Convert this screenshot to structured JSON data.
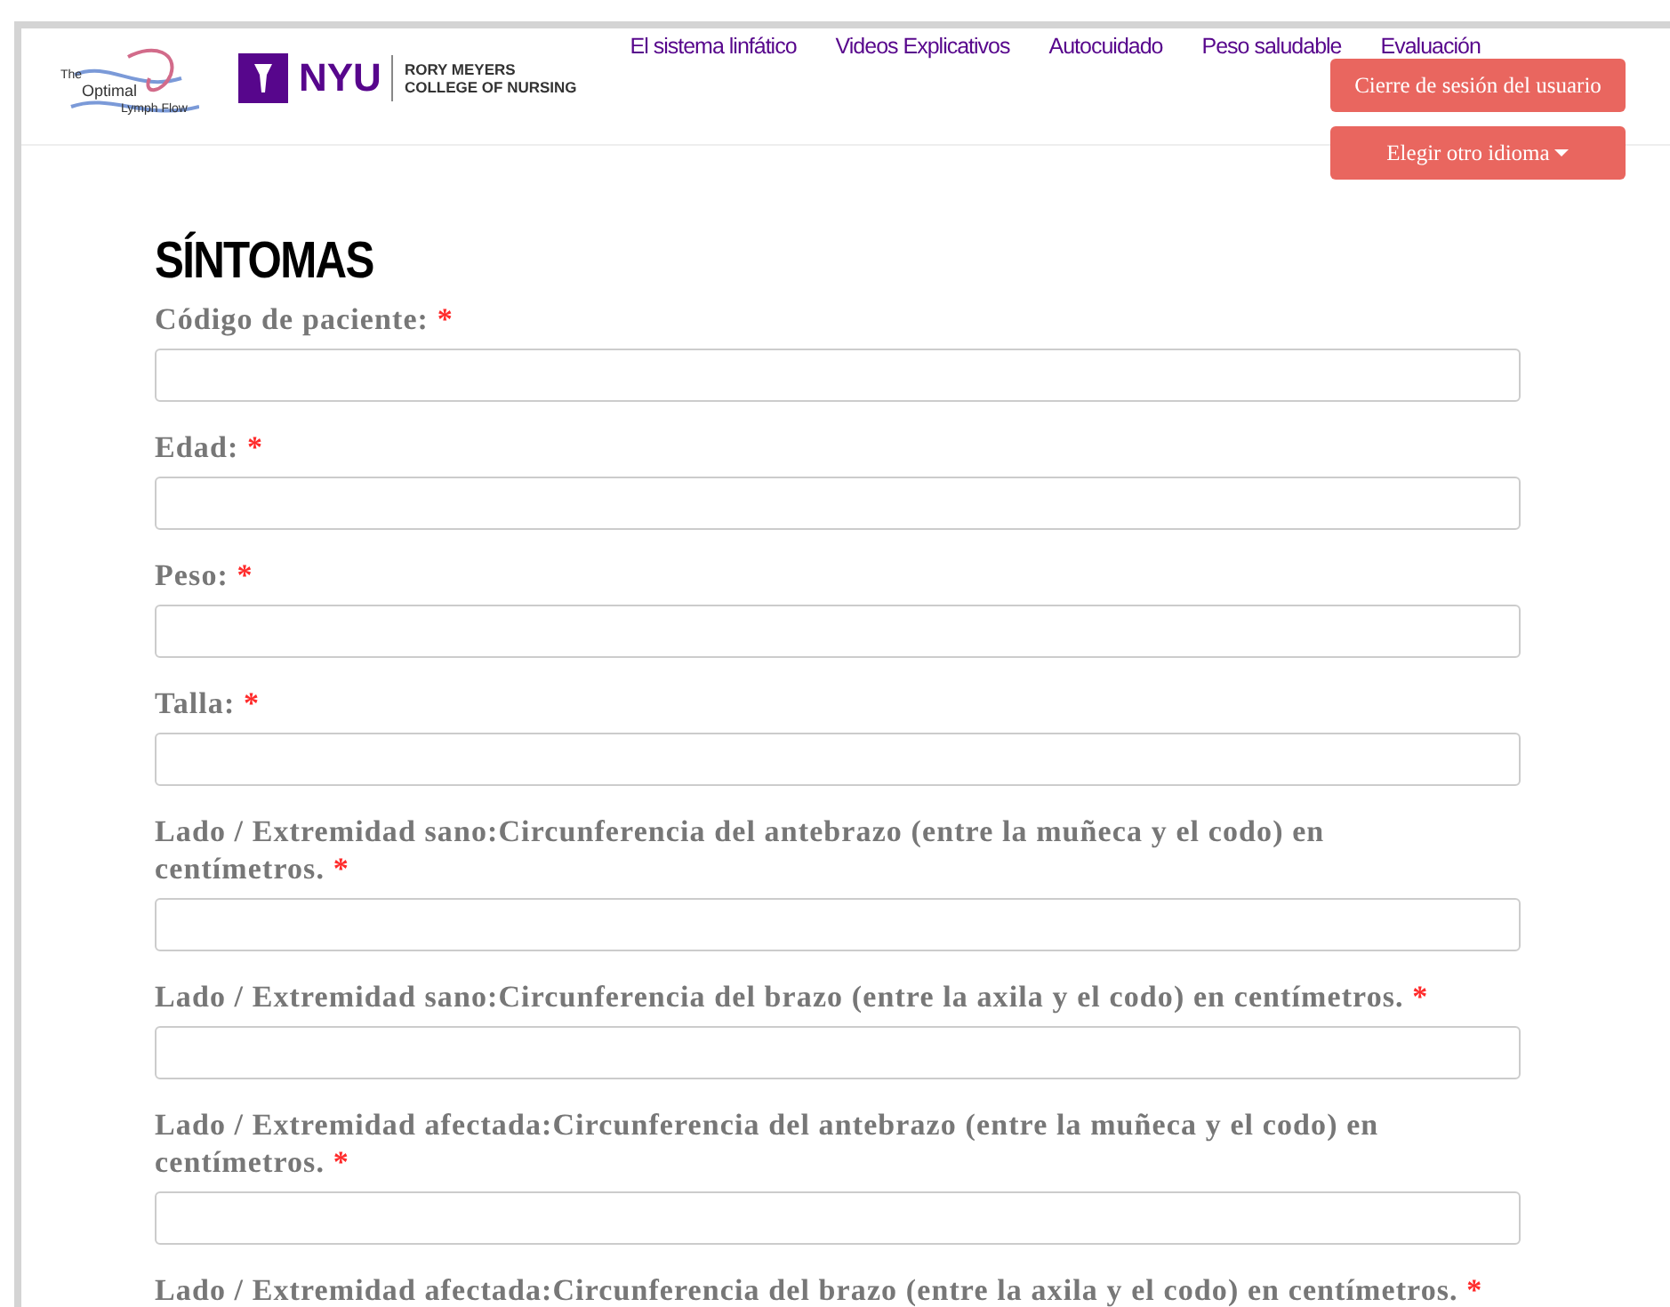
{
  "header": {
    "logo_optimal": [
      "The",
      "Optimal",
      "Lymph Flow"
    ],
    "logo_nyu": {
      "mark": "NYU",
      "line1": "RORY MEYERS",
      "line2": "COLLEGE OF NURSING"
    },
    "nav": [
      "El sistema linfático",
      "Videos Explicativos",
      "Autocuidado",
      "Peso saludable",
      "Evaluación"
    ],
    "buttons": [
      {
        "label": "Cierre de sesión del usuario",
        "kind": "plain"
      },
      {
        "label": "Elegir otro idioma",
        "kind": "dropdown"
      }
    ]
  },
  "title": "SÍNTOMAS",
  "fields": [
    {
      "label": "Código de paciente:",
      "required_mark": "*"
    },
    {
      "label": "Edad:",
      "required_mark": "*"
    },
    {
      "label": "Peso:",
      "required_mark": "*"
    },
    {
      "label": "Talla:",
      "required_mark": "*"
    },
    {
      "label": "Lado / Extremidad sano:Circunferencia del antebrazo (entre la muñeca y el codo) en centímetros.",
      "required_mark": "*"
    },
    {
      "label": "Lado / Extremidad sano:Circunferencia del brazo (entre la axila y el codo) en centímetros.",
      "required_mark": "*"
    },
    {
      "label": "Lado / Extremidad afectada:Circunferencia del antebrazo (entre la muñeca y el codo) en centímetros.",
      "required_mark": "*"
    }
  ],
  "last_label": {
    "label": "Lado / Extremidad afectada:Circunferencia del brazo (entre la axila y el codo) en centímetros.",
    "required_mark": "*"
  }
}
